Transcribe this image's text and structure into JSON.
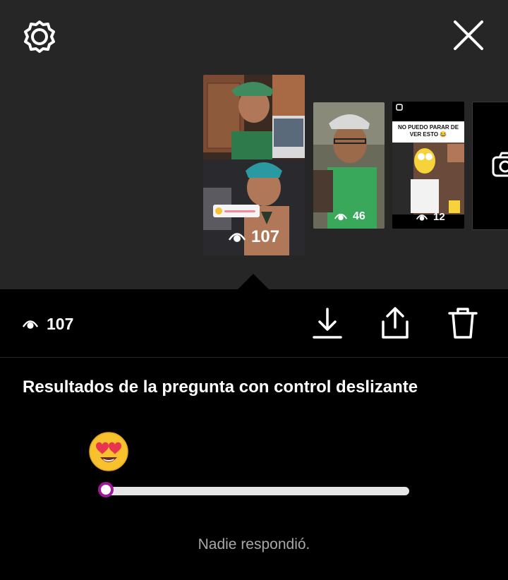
{
  "header": {
    "settings_icon": "gear-icon",
    "close_icon": "close-icon"
  },
  "stories": [
    {
      "views": "107",
      "sticker_emoji": "😍"
    },
    {
      "views": "46"
    },
    {
      "views": "12",
      "meme_text": "NO PUEDO PARAR DE VER ESTO 😂"
    },
    {
      "icon": "camera-icon"
    }
  ],
  "action_bar": {
    "view_count": "107",
    "download_icon": "download-icon",
    "share_icon": "share-icon",
    "delete_icon": "trash-icon"
  },
  "slider_result": {
    "title": "Resultados de la pregunta con control deslizante",
    "emoji": "😍",
    "value_percent": 0,
    "empty_message": "Nadie respondió.",
    "accent_color": "#a0179e"
  },
  "colors": {
    "top_background": "#262626",
    "main_background": "#000000",
    "muted_text": "#a8a8a8"
  }
}
